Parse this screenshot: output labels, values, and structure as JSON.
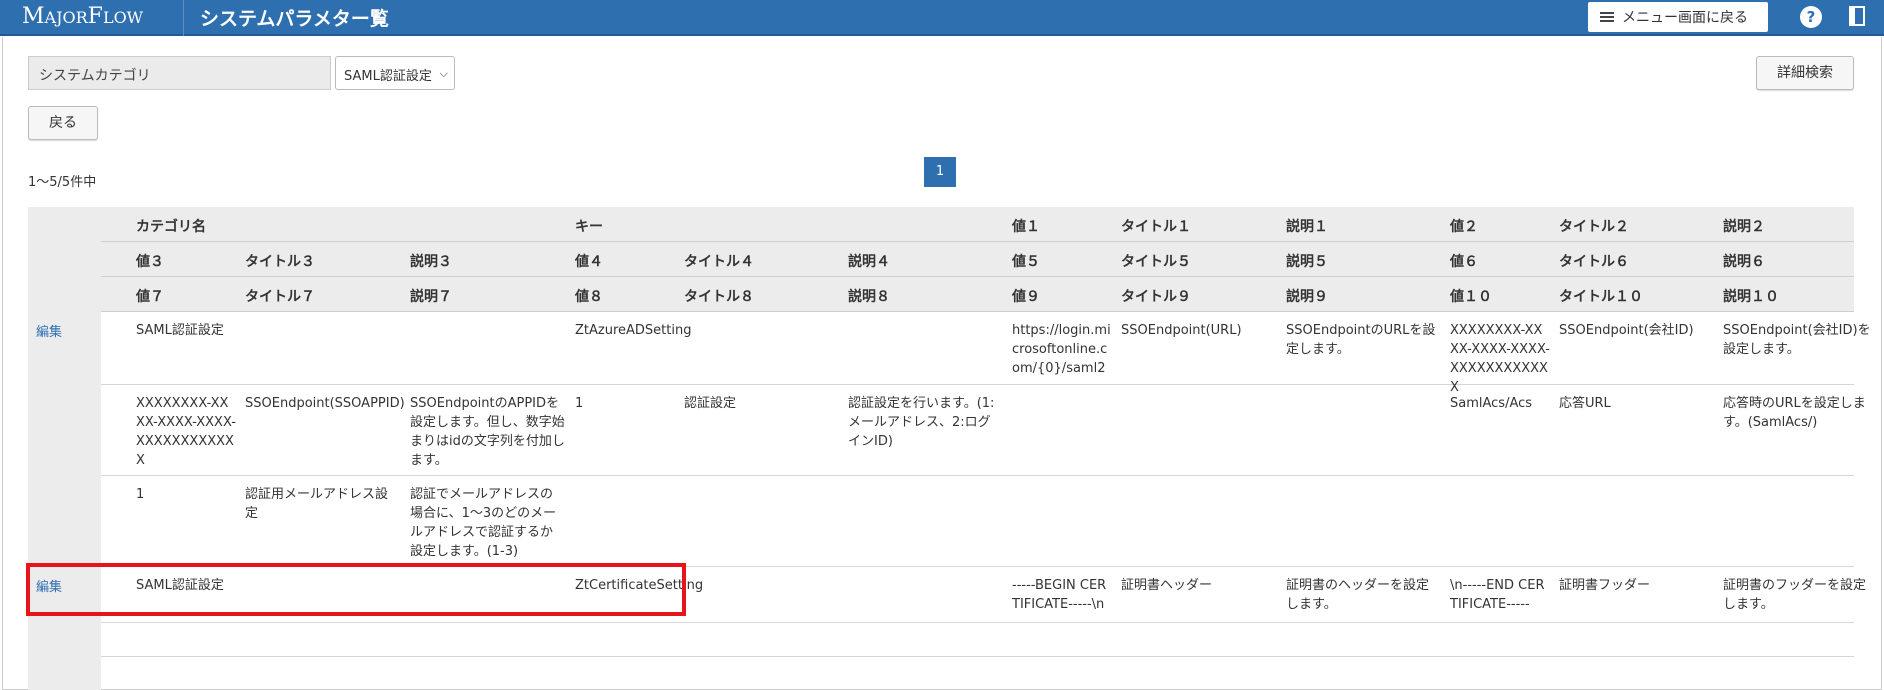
{
  "header": {
    "logo": "MAJORFLOW",
    "title": "システムパラメター覧",
    "menu_return": "メニュー画面に戻る",
    "help": "?"
  },
  "filter": {
    "category_label": "システムカテゴリ",
    "category_value": "SAML認証設定",
    "back": "戻る",
    "detail_search": "詳細検索"
  },
  "paging": {
    "count": "1～5/5件中",
    "page": "1"
  },
  "columns": {
    "row1": [
      "カテゴリ名",
      "キー",
      "値１",
      "タイトル１",
      "説明１",
      "値２",
      "タイトル２",
      "説明２"
    ],
    "row2": [
      "値３",
      "タイトル３",
      "説明３",
      "値４",
      "タイトル４",
      "説明４",
      "値５",
      "タイトル５",
      "説明５",
      "値６",
      "タイトル６",
      "説明６"
    ],
    "row3": [
      "値７",
      "タイトル７",
      "説明７",
      "値８",
      "タイトル８",
      "説明８",
      "値９",
      "タイトル９",
      "説明９",
      "値１０",
      "タイトル１０",
      "説明１０"
    ]
  },
  "records": [
    {
      "edit": "編集",
      "line1": [
        "SAML認証設定",
        "ZtAzureADSetting",
        "https://login.microsoftonline.com/{0}/saml2",
        "SSOEndpoint(URL)",
        "SSOEndpointのURLを設定します。",
        "XXXXXXXX-XXXX-XXXX-XXXX-XXXXXXXXXXXX",
        "SSOEndpoint(会社ID)",
        "SSOEndpoint(会社ID)を設定します。"
      ],
      "line2": [
        "XXXXXXXX-XXXX-XXXX-XXXX-XXXXXXXXXXXX",
        "SSOEndpoint(SSOAPPID)",
        "SSOEndpointのAPPIDを設定します。但し、数字始まりはidの文字列を付加します。",
        "1",
        "認証設定",
        "認証設定を行います。(1:メールアドレス、2:ログインID)",
        "SamlAcs/Acs",
        "応答URL",
        "応答時のURLを設定します。(SamlAcs/)"
      ],
      "line3": [
        "1",
        "認証用メールアドレス設定",
        "認証でメールアドレスの場合に、1～3のどのメールアドレスで認証するか設定します。(1-3)"
      ]
    },
    {
      "edit": "編集",
      "line1": [
        "SAML認証設定",
        "ZtCertificateSetting",
        "-----BEGIN CERTIFICATE-----\\n",
        "証明書ヘッダー",
        "証明書のヘッダーを設定します。",
        "\\n-----END CERTIFICATE-----",
        "証明書フッダー",
        "証明書のフッダーを設定します。"
      ]
    }
  ]
}
